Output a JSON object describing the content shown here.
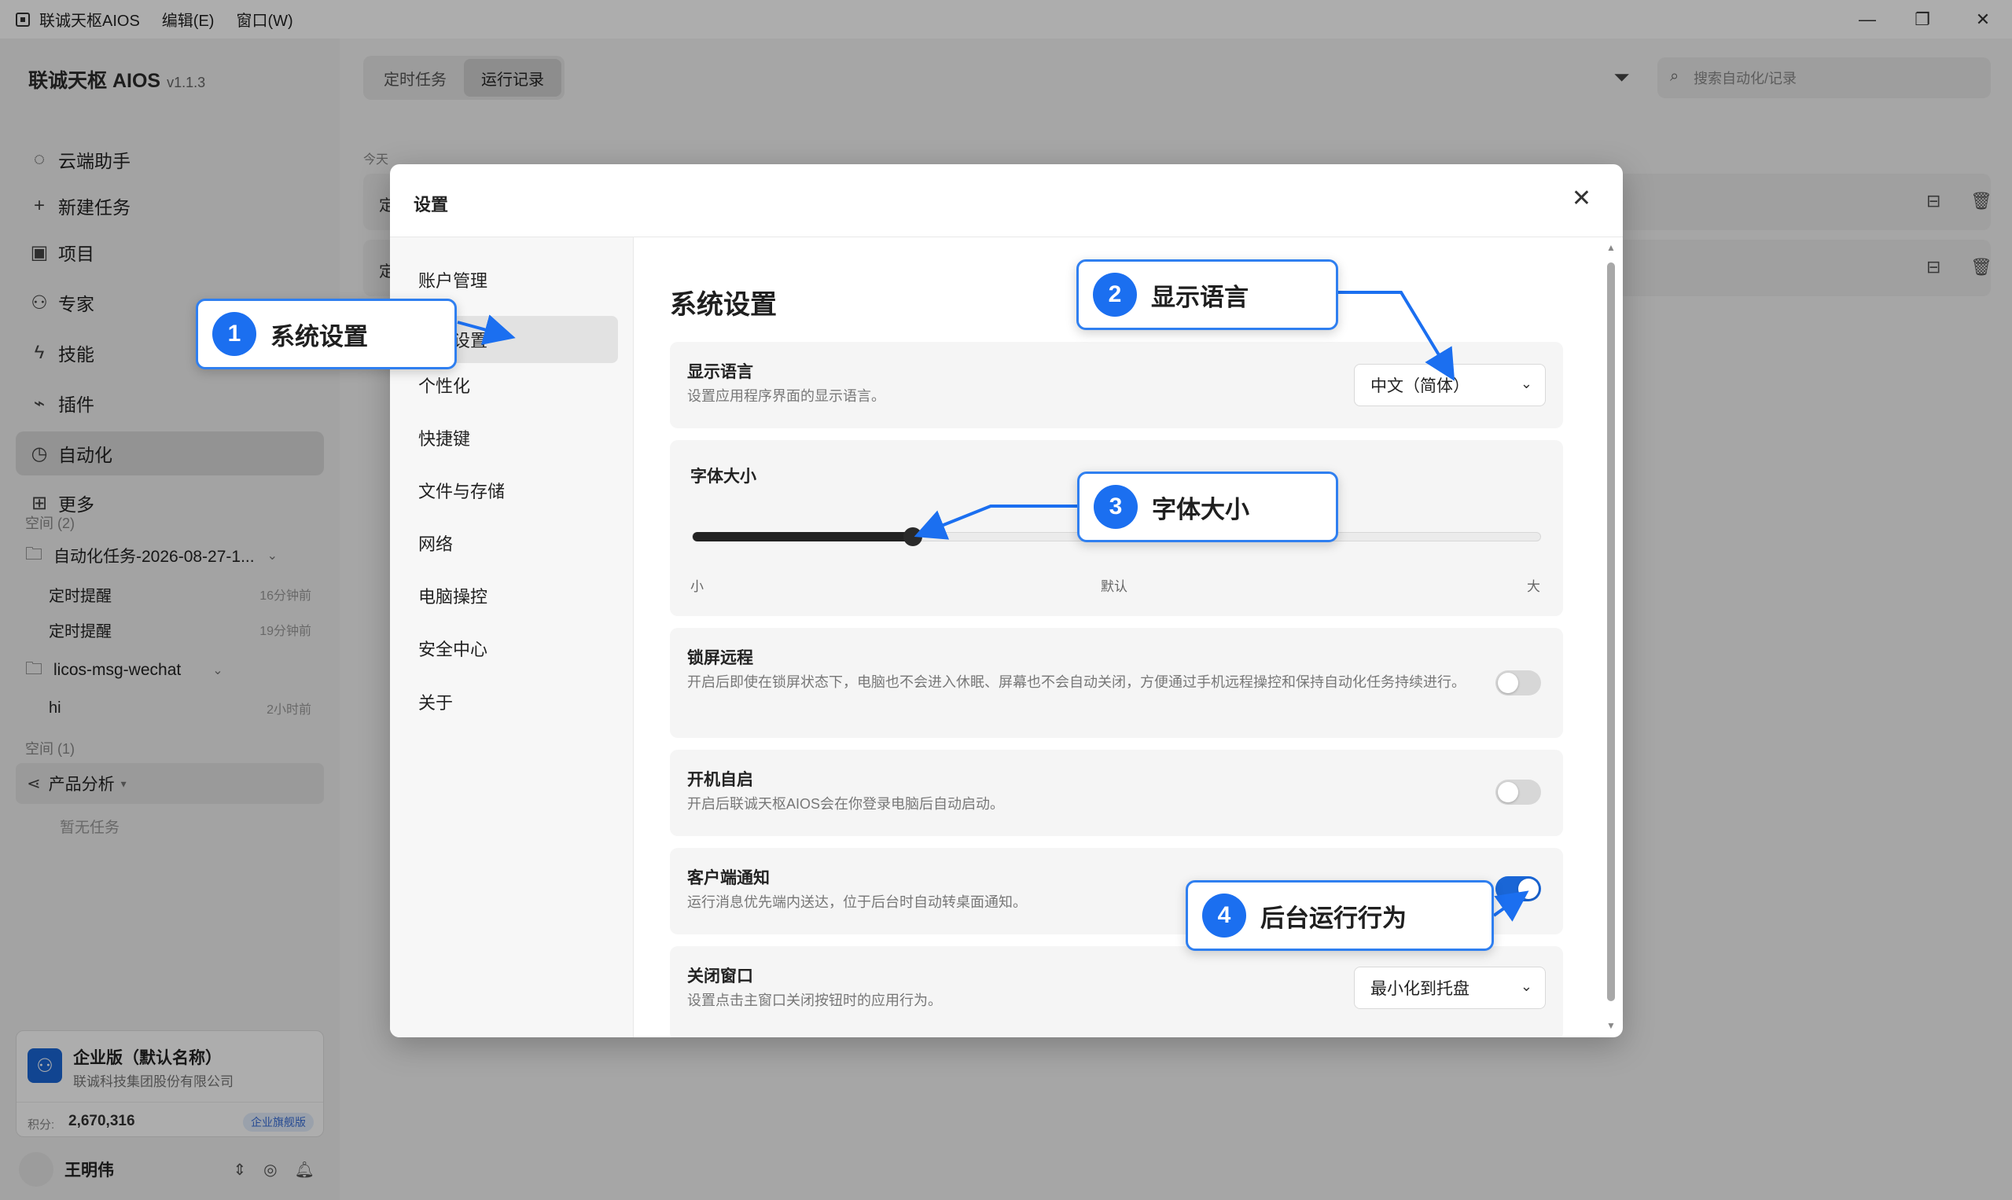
{
  "titlebar": {
    "app_title": "联诚天枢AIOS",
    "menu_edit": "编辑(E)",
    "menu_window": "窗口(W)",
    "minimize": "—",
    "restore": "❐",
    "close": "✕"
  },
  "sidebar": {
    "brand": "联诚天枢 AIOS",
    "version": "v1.1.3",
    "nav": [
      {
        "label": "云端助手",
        "icon": "chat-bubble-icon",
        "glyph": "◌"
      },
      {
        "label": "新建任务",
        "icon": "plus-icon",
        "glyph": "+"
      },
      {
        "label": "项目",
        "icon": "board-icon",
        "glyph": "▣"
      },
      {
        "label": "专家",
        "icon": "expert-icon",
        "glyph": "⚇"
      },
      {
        "label": "技能",
        "icon": "lightning-icon",
        "glyph": "ϟ"
      },
      {
        "label": "插件",
        "icon": "plug-icon",
        "glyph": "⌁"
      },
      {
        "label": "自动化",
        "icon": "clock-icon",
        "glyph": "◷"
      },
      {
        "label": "更多",
        "icon": "grid-icon",
        "glyph": "⊞"
      }
    ],
    "space_label_1": "空间 (2)",
    "folder_1": "自动化任务-2026-08-27-1...",
    "folder_1_items": [
      {
        "label": "定时提醒",
        "time": "16分钟前"
      },
      {
        "label": "定时提醒",
        "time": "19分钟前"
      }
    ],
    "folder_2": "licos-msg-wechat",
    "folder_2_items": [
      {
        "label": "hi",
        "time": "2小时前"
      }
    ],
    "space_label_2": "空间 (1)",
    "space_item": "产品分析",
    "space_empty": "暂无任务",
    "org": {
      "name": "企业版（默认名称）",
      "company": "联诚科技集团股份有限公司",
      "points_label": "积分:",
      "points_value": "2,670,316",
      "plan_badge": "企业旗舰版"
    },
    "user": {
      "name": "王明伟"
    }
  },
  "main": {
    "tabs": [
      "定时任务",
      "运行记录"
    ],
    "search_placeholder": "搜索自动化/记录",
    "today_label": "今天",
    "records": [
      {
        "text": "定"
      },
      {
        "text": "定"
      }
    ]
  },
  "modal": {
    "title": "设置",
    "nav": [
      "账户管理",
      "系统设置",
      "个性化",
      "快捷键",
      "文件与存储",
      "网络",
      "电脑操控",
      "安全中心",
      "关于"
    ],
    "content_title": "系统设置",
    "language": {
      "title": "显示语言",
      "desc": "设置应用程序界面的显示语言。",
      "value": "中文（简体）"
    },
    "font_size": {
      "title": "字体大小",
      "label_small": "小",
      "label_default": "默认",
      "label_large": "大",
      "level": 0.26
    },
    "lock_remote": {
      "title": "锁屏远程",
      "desc": "开启后即使在锁屏状态下，电脑也不会进入休眠、屏幕也不会自动关闭，方便通过手机远程操控和保持自动化任务持续进行。",
      "enabled": false
    },
    "autostart": {
      "title": "开机自启",
      "desc": "开启后联诚天枢AIOS会在你登录电脑后自动启动。",
      "enabled": false
    },
    "client_notify": {
      "title": "客户端通知",
      "desc": "运行消息优先端内送达，位于后台时自动转桌面通知。",
      "enabled": true
    },
    "close_window": {
      "title": "关闭窗口",
      "desc": "设置点击主窗口关闭按钮时的应用行为。",
      "value": "最小化到托盘"
    }
  },
  "callouts": [
    {
      "num": "1",
      "text": "系统设置"
    },
    {
      "num": "2",
      "text": "显示语言"
    },
    {
      "num": "3",
      "text": "字体大小"
    },
    {
      "num": "4",
      "text": "后台运行行为"
    }
  ],
  "colors": {
    "accent": "#1b6ff0",
    "callout_border": "#2f7ff0",
    "toggle_on": "#1a66d6"
  }
}
